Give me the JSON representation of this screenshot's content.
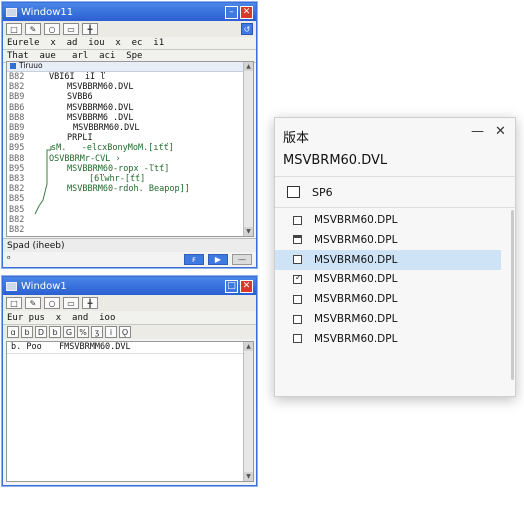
{
  "window1": {
    "title": "Window11",
    "menu": "Eurele  x  ad  iou  x  ec  i1",
    "subtitle": "That  aue   arl  aci  Spe",
    "editor_header": "Tiruuo",
    "code_lines": [
      {
        "num": "B82",
        "text": "VBI6I  iI ľ",
        "green": false
      },
      {
        "num": "B82",
        "text": "MSVBBRM60.DVL",
        "green": false
      },
      {
        "num": "BB9",
        "text": "SVBB6",
        "green": false
      },
      {
        "num": "BB6",
        "text": "MSVBBRM60.DVL",
        "green": false
      },
      {
        "num": "BB8",
        "text": "MSVBBRM6 .DVL",
        "green": false
      },
      {
        "num": "BB9",
        "text": "MSVBBRM60.DVL",
        "green": false
      },
      {
        "num": "BB9",
        "text": "PRPLI",
        "green": false
      },
      {
        "num": "B95",
        "text": "sM.   -elcxBonyMoM.[ıťť]",
        "green": true
      },
      {
        "num": "BB8",
        "text": "OSVBBRMr-CVL ›",
        "green": true
      },
      {
        "num": "B95",
        "text": "MSVBBRM60-ropx -ľtť]",
        "green": true
      },
      {
        "num": "B83",
        "text": "[6ľwhr-[ťť]",
        "green": true
      },
      {
        "num": "B82",
        "text": "MSVBBRM60-rdoh. Beapop]]",
        "green": true
      },
      {
        "num": "B85",
        "text": "",
        "green": false
      },
      {
        "num": "B85",
        "text": "",
        "green": false
      },
      {
        "num": "B82",
        "text": "",
        "green": false
      },
      {
        "num": "B82",
        "text": "",
        "green": false
      }
    ],
    "status": "Spad  (iheeb)",
    "status2": "ᵒ"
  },
  "window2": {
    "title": "Window1",
    "menu": "Eur pus  x  and  ioo",
    "row_label": "b. Poo",
    "row_value": "FMSVBRMM60.DVL"
  },
  "panel": {
    "title": "版本",
    "minimize": "—",
    "close": "✕",
    "subtitle": "MSVBRM60.DVL",
    "group_label": "SP6",
    "items": [
      {
        "label": "MSVBRM60.DPL",
        "state": "unchecked",
        "selected": false
      },
      {
        "label": "MSVBRM60.DPL",
        "state": "header",
        "selected": false
      },
      {
        "label": "MSVBRM60.DPL",
        "state": "unchecked",
        "selected": true
      },
      {
        "label": "MSVBRM60.DPL",
        "state": "checked",
        "selected": false
      },
      {
        "label": "MSVBRM60.DPL",
        "state": "unchecked",
        "selected": false
      },
      {
        "label": "MSVBRM60.DPL",
        "state": "unchecked",
        "selected": false
      },
      {
        "label": "MSVBRM60.DPL",
        "state": "unchecked",
        "selected": false
      }
    ]
  }
}
